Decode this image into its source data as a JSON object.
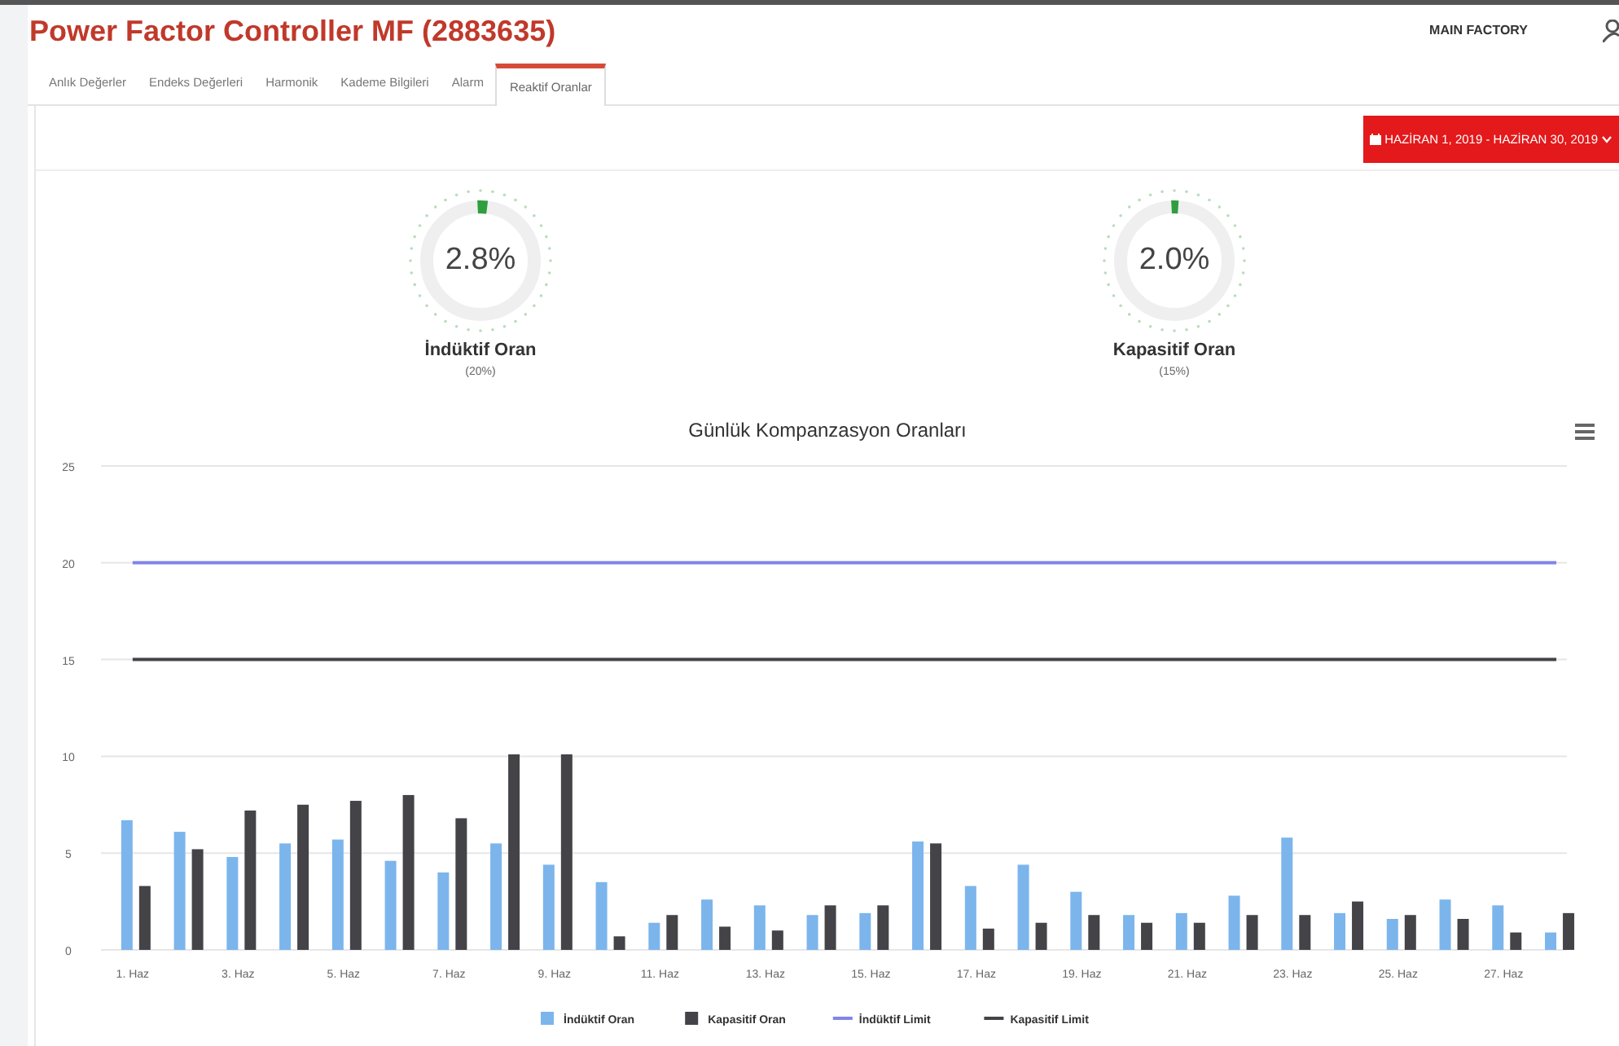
{
  "header": {
    "title": "Power Factor Controller MF (2883635)",
    "factory": "MAIN FACTORY"
  },
  "tabs": [
    {
      "label": "Anlık Değerler",
      "selected": false
    },
    {
      "label": "Endeks Değerleri",
      "selected": false
    },
    {
      "label": "Harmonik",
      "selected": false
    },
    {
      "label": "Kademe Bilgileri",
      "selected": false
    },
    {
      "label": "Alarm",
      "selected": false
    },
    {
      "label": "Reaktif Oranlar",
      "selected": true
    }
  ],
  "date_range": {
    "label": "HAZİRAN 1, 2019 - HAZİRAN 30, 2019"
  },
  "gauges": [
    {
      "value": "2.8%",
      "level": 0.028,
      "label": "İndüktif Oran",
      "limit": "(20%)"
    },
    {
      "value": "2.0%",
      "level": 0.02,
      "label": "Kapasitif Oran",
      "limit": "(15%)"
    }
  ],
  "chart": {
    "chart_data": {
      "type": "bar",
      "title": "Günlük Kompanzasyon Oranları",
      "x": [
        1,
        2,
        3,
        4,
        5,
        6,
        7,
        8,
        9,
        10,
        11,
        12,
        13,
        14,
        15,
        16,
        17,
        18,
        19,
        20,
        21,
        22,
        23,
        24,
        25,
        26,
        27,
        28
      ],
      "grid": true,
      "legend": "bottom",
      "xlim": [
        0.4,
        28.2
      ],
      "ylim": [
        0,
        25
      ],
      "yticks": [
        0,
        5,
        10,
        15,
        20,
        25
      ],
      "xticks": [
        {
          "value": 1,
          "label": "1. Haz"
        },
        {
          "value": 3,
          "label": "3. Haz"
        },
        {
          "value": 5,
          "label": "5. Haz"
        },
        {
          "value": 7,
          "label": "7. Haz"
        },
        {
          "value": 9,
          "label": "9. Haz"
        },
        {
          "value": 11,
          "label": "11. Haz"
        },
        {
          "value": 13,
          "label": "13. Haz"
        },
        {
          "value": 15,
          "label": "15. Haz"
        },
        {
          "value": 17,
          "label": "17. Haz"
        },
        {
          "value": 19,
          "label": "19. Haz"
        },
        {
          "value": 21,
          "label": "21. Haz"
        },
        {
          "value": 23,
          "label": "23. Haz"
        },
        {
          "value": 25,
          "label": "25. Haz"
        },
        {
          "value": 27,
          "label": "27. Haz"
        }
      ],
      "series": [
        {
          "name": "İndüktif Oran",
          "color": "#7cb5ec",
          "values": [
            6.7,
            6.1,
            4.8,
            5.5,
            5.7,
            4.6,
            4.0,
            5.5,
            4.4,
            3.5,
            1.4,
            2.6,
            2.3,
            1.8,
            1.9,
            5.6,
            3.3,
            4.4,
            3.0,
            1.8,
            1.9,
            2.8,
            5.8,
            1.9,
            1.6,
            2.6,
            2.3,
            0.9
          ]
        },
        {
          "name": "Kapasitif Oran",
          "color": "#434348",
          "values": [
            3.3,
            5.2,
            7.2,
            7.5,
            7.7,
            8.0,
            6.8,
            10.1,
            10.1,
            0.7,
            1.8,
            1.2,
            1.0,
            2.3,
            2.3,
            5.5,
            1.1,
            1.4,
            1.8,
            1.4,
            1.4,
            1.8,
            1.8,
            2.5,
            1.8,
            1.6,
            0.9,
            1.9
          ]
        },
        {
          "name": "İndüktif Limit",
          "type": "line",
          "color": "#8085e9",
          "values": [
            20,
            20,
            20,
            20,
            20,
            20,
            20,
            20,
            20,
            20,
            20,
            20,
            20,
            20,
            20,
            20,
            20,
            20,
            20,
            20,
            20,
            20,
            20,
            20,
            20,
            20,
            20,
            20
          ]
        },
        {
          "name": "Kapasitif Limit",
          "type": "line",
          "color": "#434348",
          "values": [
            15,
            15,
            15,
            15,
            15,
            15,
            15,
            15,
            15,
            15,
            15,
            15,
            15,
            15,
            15,
            15,
            15,
            15,
            15,
            15,
            15,
            15,
            15,
            15,
            15,
            15,
            15,
            15
          ]
        }
      ]
    }
  }
}
